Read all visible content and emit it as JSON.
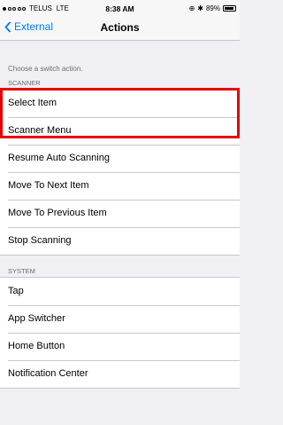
{
  "status_bar": {
    "carrier": "TELUS",
    "network": "LTE",
    "time": "8:38 AM",
    "battery": "89%",
    "battery_level": 0.89,
    "signal_bars_filled": 1,
    "signal_bars_total": 5
  },
  "nav": {
    "back_label": "External",
    "title": "Actions"
  },
  "list_header": "Choose a switch action.",
  "sections": {
    "scanner": {
      "title": "SCANNER",
      "items": [
        "Select Item",
        "Scanner Menu",
        "Resume Auto Scanning",
        "Move To Next Item",
        "Move To Previous Item",
        "Stop Scanning"
      ]
    },
    "system": {
      "title": "SYSTEM",
      "items": [
        "Tap",
        "App Switcher",
        "Home Button",
        "Notification Center"
      ]
    }
  },
  "colors": {
    "accent": "#007aff",
    "highlight": "#e60000"
  }
}
